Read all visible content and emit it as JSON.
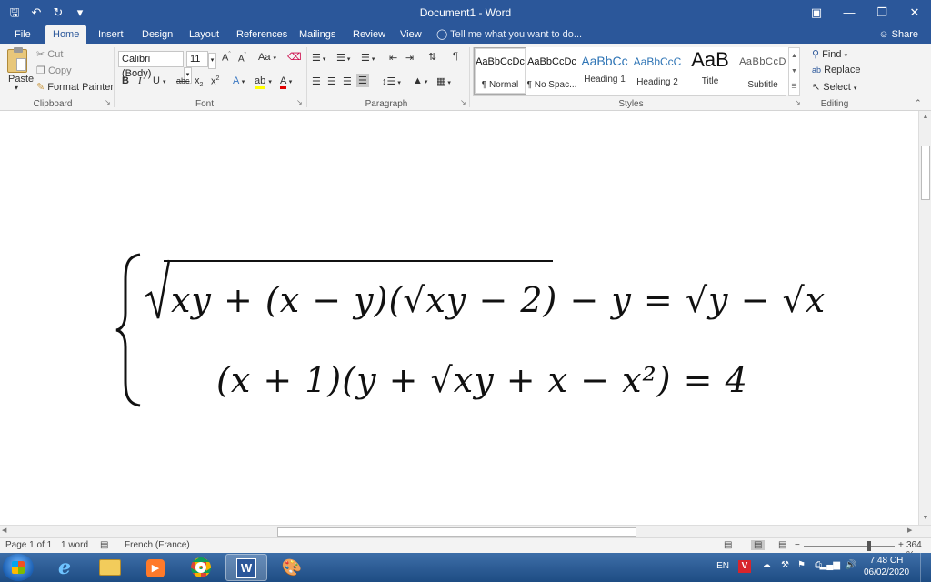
{
  "window": {
    "title": "Document1 - Word",
    "quick_access": [
      "save-icon",
      "undo-icon",
      "redo-icon",
      "customize-icon"
    ]
  },
  "tabs": [
    {
      "label": "File",
      "active": false
    },
    {
      "label": "Home",
      "active": true
    },
    {
      "label": "Insert",
      "active": false
    },
    {
      "label": "Design",
      "active": false
    },
    {
      "label": "Layout",
      "active": false
    },
    {
      "label": "References",
      "active": false
    },
    {
      "label": "Mailings",
      "active": false
    },
    {
      "label": "Review",
      "active": false
    },
    {
      "label": "View",
      "active": false
    }
  ],
  "tell_me": "Tell me what you want to do...",
  "share_label": "Share",
  "clipboard": {
    "group_label": "Clipboard",
    "paste": "Paste",
    "cut": "Cut",
    "copy": "Copy",
    "format_painter": "Format Painter"
  },
  "font": {
    "group_label": "Font",
    "name": "Calibri (Body)",
    "size": "11",
    "case_label": "Aa"
  },
  "paragraph": {
    "group_label": "Paragraph"
  },
  "styles": {
    "group_label": "Styles",
    "items": [
      {
        "preview": "AaBbCcDc",
        "name": "¶ Normal",
        "selected": true
      },
      {
        "preview": "AaBbCcDc",
        "name": "¶ No Spac...",
        "selected": false
      },
      {
        "preview": "AaBbCc",
        "name": "Heading 1",
        "selected": false
      },
      {
        "preview": "AaBbCcC",
        "name": "Heading 2",
        "selected": false
      },
      {
        "preview": "AaB",
        "name": "Title",
        "selected": false
      },
      {
        "preview": "AaBbCcD",
        "name": "Subtitle",
        "selected": false
      }
    ]
  },
  "editing": {
    "group_label": "Editing",
    "find": "Find",
    "replace": "Replace",
    "select": "Select"
  },
  "equation": {
    "line1": "xy + (x − y)(√xy − 2) − y = √y − √x",
    "line2": "(x + 1)(y + √xy + x − x²) = 4"
  },
  "status": {
    "page": "Page 1 of 1",
    "words": "1 word",
    "language": "French (France)",
    "zoom": "364 %"
  },
  "taskbar": {
    "lang": "EN",
    "time": "7:48 CH",
    "date": "06/02/2020"
  }
}
